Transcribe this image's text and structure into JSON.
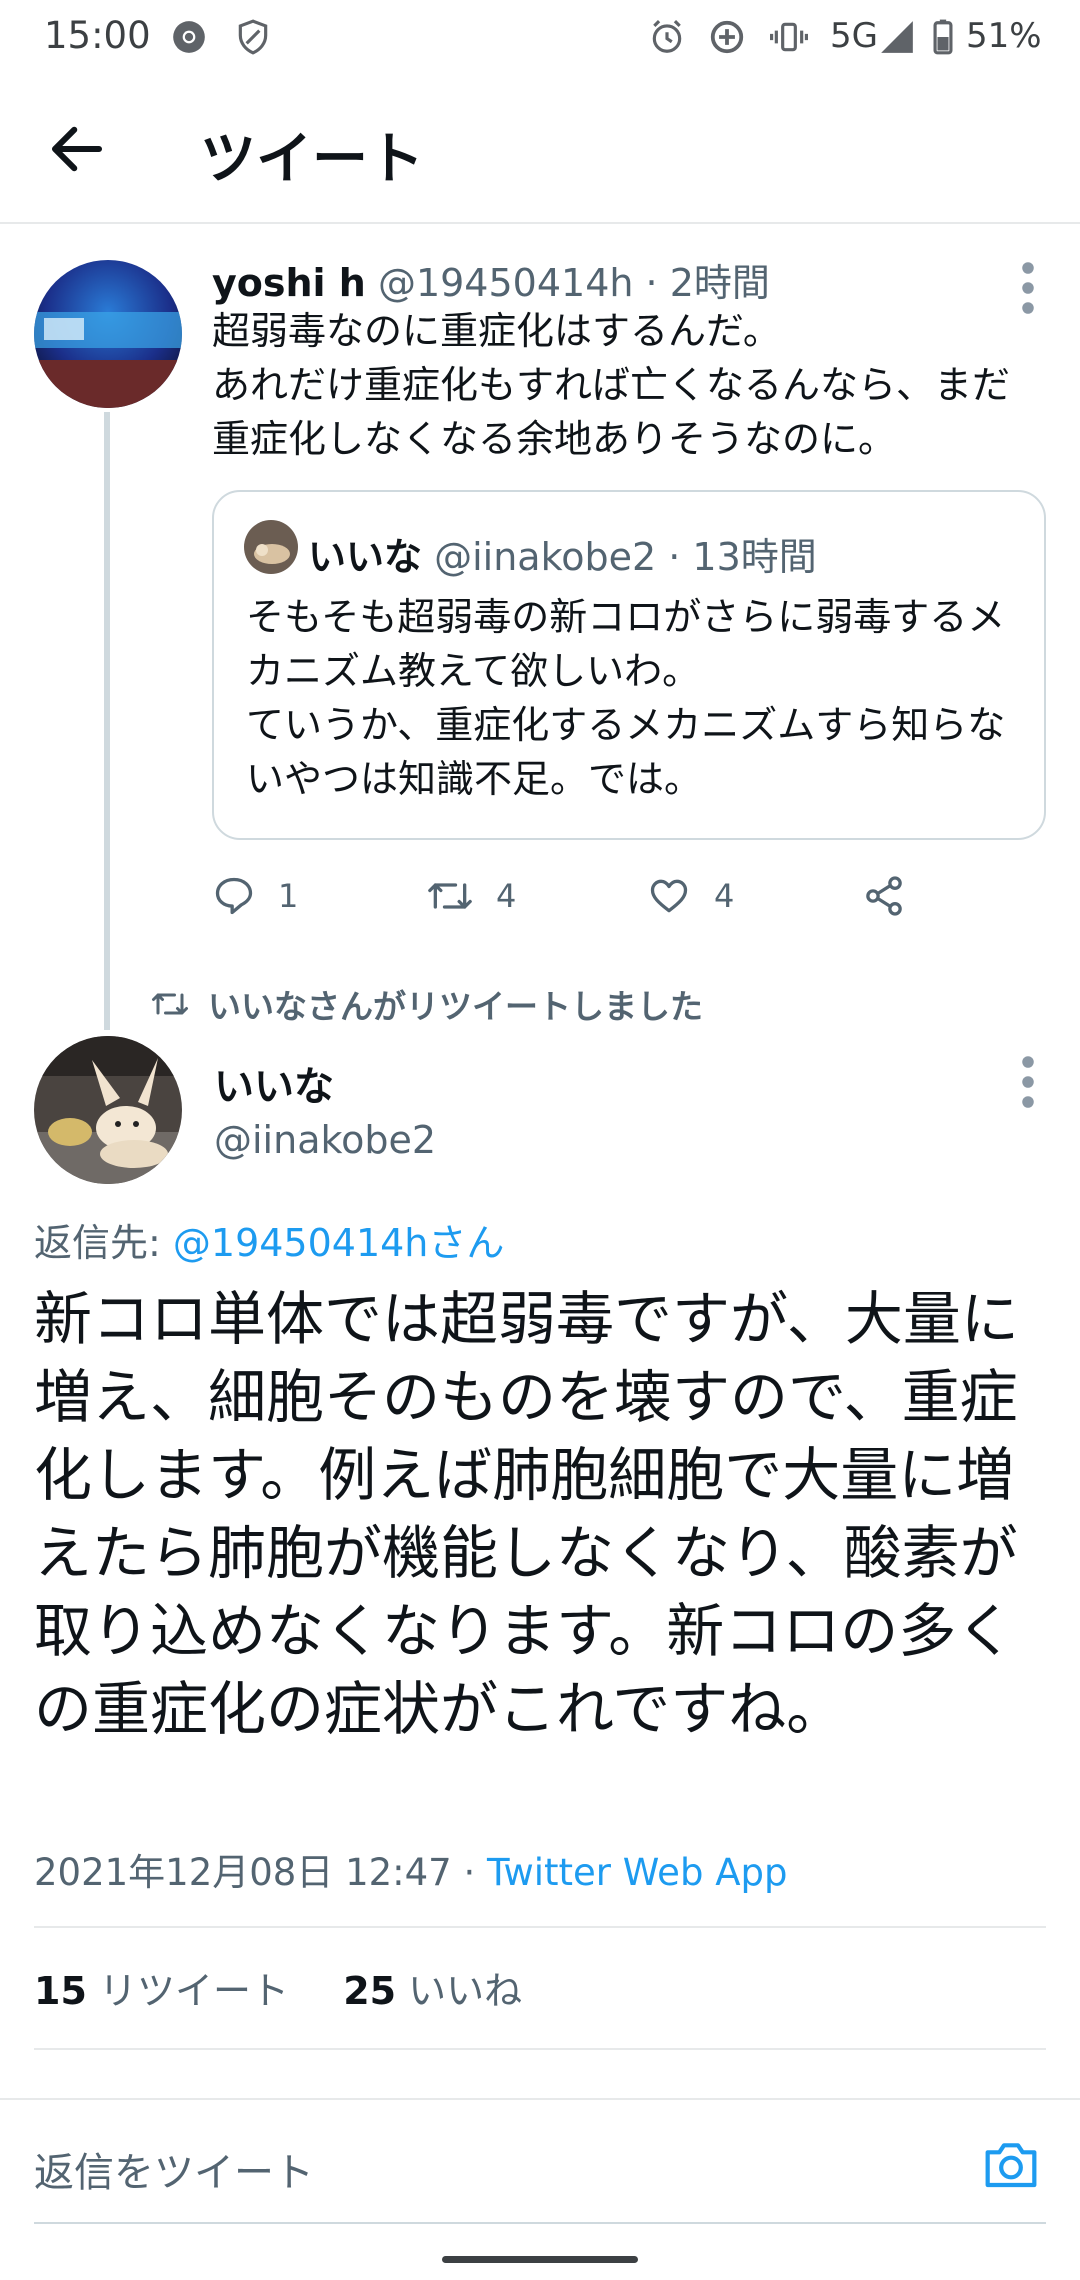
{
  "status_bar": {
    "time": "15:00",
    "network": "5G",
    "battery": "51%",
    "icons": [
      "chrome-icon",
      "shield-icon",
      "alarm-icon",
      "data-saver-icon",
      "vibrate-icon",
      "signal-icon",
      "battery-icon"
    ]
  },
  "app_bar": {
    "title": "ツイート"
  },
  "tweet1": {
    "name": "yoshi h",
    "handle_time": "@19450414h · 2時間",
    "text": "超弱毒なのに重症化はするんだ。\nあれだけ重症化もすれば亡くなるんなら、まだ重症化しなくなる余地ありそうなのに。",
    "quote": {
      "name": "いいな",
      "handle_time": "@iinakobe2 · 13時間",
      "text": "そもそも超弱毒の新コロがさらに弱毒するメカニズム教えて欲しいわ。\nていうか、重症化するメカニズムすら知らないやつは知識不足。では。"
    },
    "actions": {
      "replies": "1",
      "retweets": "4",
      "likes": "4"
    }
  },
  "retweet_note": "いいなさんがリツイートしました",
  "tweet2": {
    "name": "いいな",
    "handle": "@iinakobe2",
    "reply_prefix": "返信先: ",
    "reply_to": "@19450414hさん",
    "text": "新コロ単体では超弱毒ですが、大量に増え、細胞そのものを壊すので、重症化します。例えば肺胞細胞で大量に増えたら肺胞が機能しなくなり、酸素が取り込めなくなります。新コロの多くの重症化の症状がこれですね。",
    "timestamp": "2021年12月08日 12:47 · ",
    "client": "Twitter Web App",
    "retweet_count": "15",
    "retweet_label": "リツイート",
    "like_count": "25",
    "like_label": "いいね"
  },
  "reply_bar": {
    "placeholder": "返信をツイート"
  },
  "colors": {
    "accent": "#1d9bf0",
    "text": "#0f1419",
    "secondary": "#536471",
    "border": "#cfd9de"
  }
}
